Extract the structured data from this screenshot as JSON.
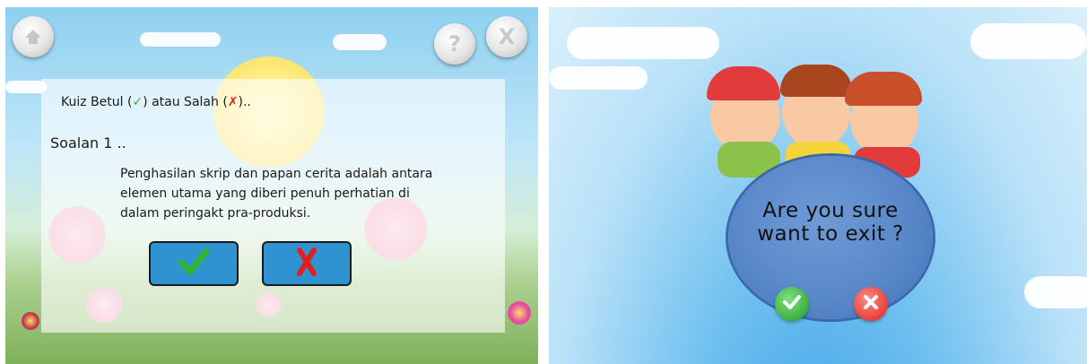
{
  "quiz_screen": {
    "home_icon": "home-icon",
    "help_label": "?",
    "close_label": "X",
    "instruction_prefix": "Kuiz Betul (",
    "instruction_mid": ") atau Salah (",
    "instruction_suffix": ")..",
    "question_title": "Soalan 1 ..",
    "question_lines": [
      "Penghasilan skrip dan papan cerita adalah antara",
      "elemen utama yang diberi penuh perhatian di",
      "dalam peringakt pra-produksi."
    ],
    "true_icon": "check-icon",
    "false_icon": "cross-icon",
    "colors": {
      "button": "#2f93d1",
      "check": "#34b233",
      "cross": "#e02020"
    }
  },
  "exit_screen": {
    "prompt_line1": "Are you sure",
    "prompt_line2": "want to exit ?",
    "confirm_icon": "check-icon",
    "cancel_icon": "cross-icon",
    "colors": {
      "confirm": "#3cb043",
      "cancel": "#e8413a",
      "bubble": "#5786c8"
    }
  }
}
